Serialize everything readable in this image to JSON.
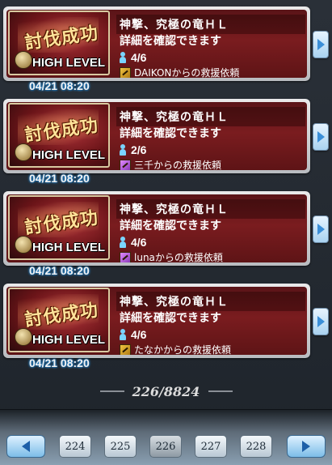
{
  "quests": [
    {
      "stamp": "討伐成功",
      "level": "HIGH LEVEL",
      "date": "04/21 08:20",
      "title": "神撃、究極の竜ＨＬ",
      "detail": "詳細を確認できます",
      "players": "4/6",
      "requester": "DAIKONからの救援依頼",
      "requester_icon": "gold-sword-icon"
    },
    {
      "stamp": "討伐成功",
      "level": "HIGH LEVEL",
      "date": "04/21 08:20",
      "title": "神撃、究極の竜ＨＬ",
      "detail": "詳細を確認できます",
      "players": "2/6",
      "requester": "三千からの救援依頼",
      "requester_icon": "purple-sword-icon"
    },
    {
      "stamp": "討伐成功",
      "level": "HIGH LEVEL",
      "date": "04/21 08:20",
      "title": "神撃、究極の竜ＨＬ",
      "detail": "詳細を確認できます",
      "players": "4/6",
      "requester": "lunaからの救援依頼",
      "requester_icon": "purple-sword-icon"
    },
    {
      "stamp": "討伐成功",
      "level": "HIGH LEVEL",
      "date": "04/21 08:20",
      "title": "神撃、究極の竜ＨＬ",
      "detail": "詳細を確認できます",
      "players": "4/6",
      "requester": "たなかからの救援依頼",
      "requester_icon": "gold-sword-icon"
    }
  ],
  "pagination": {
    "summary": "226/8824",
    "pages": [
      "224",
      "225",
      "226",
      "227",
      "228"
    ],
    "current": "226"
  },
  "colors": {
    "card_bg": "#7a1c1f",
    "date_glow": "#2a8cd6",
    "player_icon": "#7ad4ff",
    "nav_arrow": "#1d5fa8"
  }
}
